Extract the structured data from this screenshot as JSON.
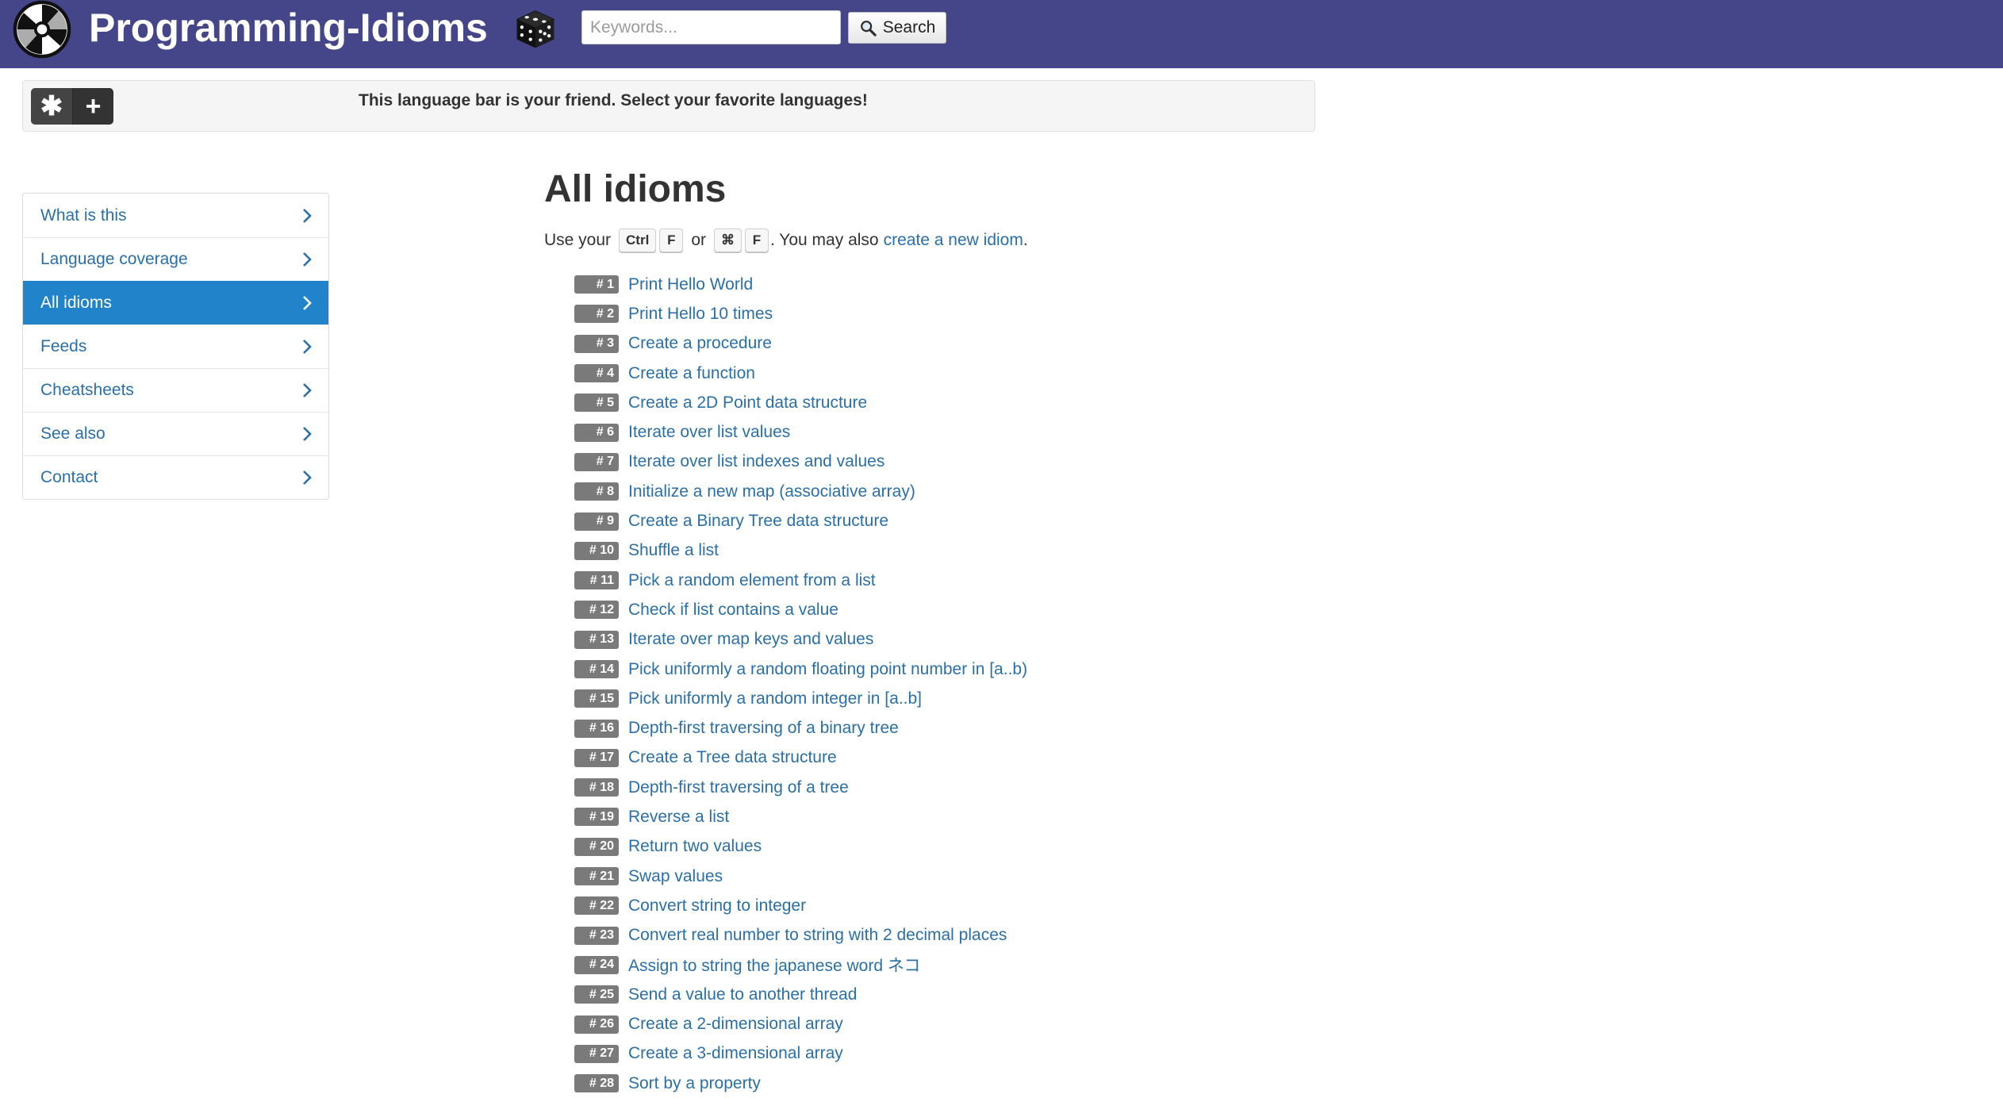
{
  "header": {
    "site_title": "Programming-Idioms",
    "search": {
      "placeholder": "Keywords...",
      "value": "",
      "button_label": "Search"
    },
    "background_color": "#45458a"
  },
  "language_bar": {
    "buttons": [
      "✱",
      "+"
    ],
    "message": "This language bar is your friend. Select your favorite languages!"
  },
  "sidebar": {
    "items": [
      {
        "label": "What is this",
        "active": false
      },
      {
        "label": "Language coverage",
        "active": false
      },
      {
        "label": "All idioms",
        "active": true
      },
      {
        "label": "Feeds",
        "active": false
      },
      {
        "label": "Cheatsheets",
        "active": false
      },
      {
        "label": "See also",
        "active": false
      },
      {
        "label": "Contact",
        "active": false
      }
    ],
    "active_color": "#2183c9"
  },
  "main": {
    "title": "All idioms",
    "hint": {
      "prefix": "Use your",
      "keys_a": [
        "Ctrl",
        "F"
      ],
      "or": "or",
      "keys_b": [
        "⌘",
        "F"
      ],
      "middle": ". You may also",
      "link": "create a new idiom",
      "suffix": "."
    },
    "idioms": [
      {
        "badge": "# 1",
        "title": "Print Hello World"
      },
      {
        "badge": "# 2",
        "title": "Print Hello 10 times"
      },
      {
        "badge": "# 3",
        "title": "Create a procedure"
      },
      {
        "badge": "# 4",
        "title": "Create a function"
      },
      {
        "badge": "# 5",
        "title": "Create a 2D Point data structure"
      },
      {
        "badge": "# 6",
        "title": "Iterate over list values"
      },
      {
        "badge": "# 7",
        "title": "Iterate over list indexes and values"
      },
      {
        "badge": "# 8",
        "title": "Initialize a new map (associative array)"
      },
      {
        "badge": "# 9",
        "title": "Create a Binary Tree data structure"
      },
      {
        "badge": "# 10",
        "title": "Shuffle a list"
      },
      {
        "badge": "# 11",
        "title": "Pick a random element from a list"
      },
      {
        "badge": "# 12",
        "title": "Check if list contains a value"
      },
      {
        "badge": "# 13",
        "title": "Iterate over map keys and values"
      },
      {
        "badge": "# 14",
        "title": "Pick uniformly a random floating point number in [a..b)"
      },
      {
        "badge": "# 15",
        "title": "Pick uniformly a random integer in [a..b]"
      },
      {
        "badge": "# 16",
        "title": "Depth-first traversing of a binary tree"
      },
      {
        "badge": "# 17",
        "title": "Create a Tree data structure"
      },
      {
        "badge": "# 18",
        "title": "Depth-first traversing of a tree"
      },
      {
        "badge": "# 19",
        "title": "Reverse a list"
      },
      {
        "badge": "# 20",
        "title": "Return two values"
      },
      {
        "badge": "# 21",
        "title": "Swap values"
      },
      {
        "badge": "# 22",
        "title": "Convert string to integer"
      },
      {
        "badge": "# 23",
        "title": "Convert real number to string with 2 decimal places"
      },
      {
        "badge": "# 24",
        "title": "Assign to string the japanese word ネコ"
      },
      {
        "badge": "# 25",
        "title": "Send a value to another thread"
      },
      {
        "badge": "# 26",
        "title": "Create a 2-dimensional array"
      },
      {
        "badge": "# 27",
        "title": "Create a 3-dimensional array"
      },
      {
        "badge": "# 28",
        "title": "Sort by a property"
      }
    ]
  },
  "icons": {
    "logo": "programming-idioms-logo",
    "dice": "dice-icon",
    "search": "magnifier-icon",
    "chevron": "chevron-right-icon"
  },
  "colors": {
    "link": "#2a6fa8",
    "badge": "#7a7a7a"
  }
}
